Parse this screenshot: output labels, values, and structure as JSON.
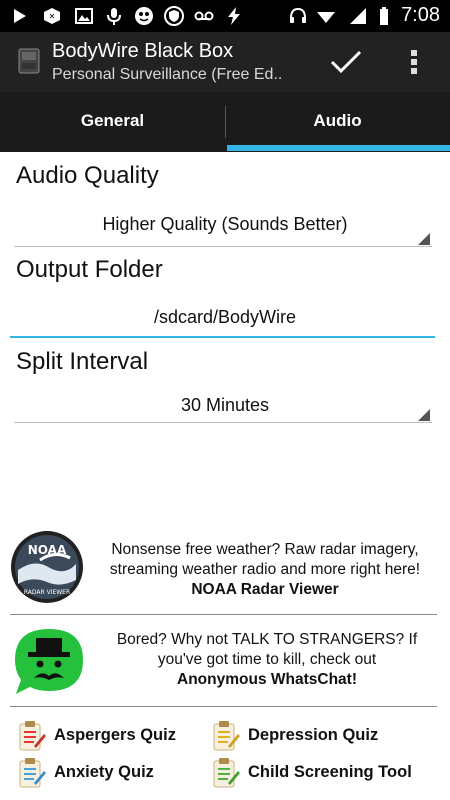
{
  "status_bar": {
    "time": "7:08",
    "icons": [
      "play-icon",
      "box-icon",
      "image-icon",
      "mic-icon",
      "face-icon",
      "shield-icon",
      "voicemail-icon",
      "bolt-icon",
      "headset-icon",
      "wifi-icon",
      "signal-icon",
      "battery-icon"
    ]
  },
  "action_bar": {
    "title": "BodyWire Black Box",
    "subtitle": "Personal Surveillance (Free Ed..",
    "accent": "#33b5e5"
  },
  "tabs": [
    {
      "label": "General",
      "selected": false
    },
    {
      "label": "Audio",
      "selected": true
    }
  ],
  "settings": {
    "audio_quality": {
      "label": "Audio Quality",
      "value": "Higher Quality (Sounds Better)"
    },
    "output_folder": {
      "label": "Output Folder",
      "value": "/sdcard/BodyWire"
    },
    "split_interval": {
      "label": "Split Interval",
      "value": "30 Minutes"
    }
  },
  "ads": [
    {
      "line1": "Nonsense free weather? Raw radar imagery,",
      "line2": "streaming weather radio and more right here!",
      "title": "NOAA Radar Viewer",
      "logo_top": "NOAA",
      "logo_bottom": "RADAR VIEWER"
    },
    {
      "line1": "Bored? Why not TALK TO STRANGERS? If",
      "line2": "you've got time to kill, check out",
      "title": "Anonymous WhatsChat!"
    }
  ],
  "quizzes": [
    "Aspergers Quiz",
    "Depression Quiz",
    "Anxiety Quiz",
    "Child Screening Tool"
  ]
}
